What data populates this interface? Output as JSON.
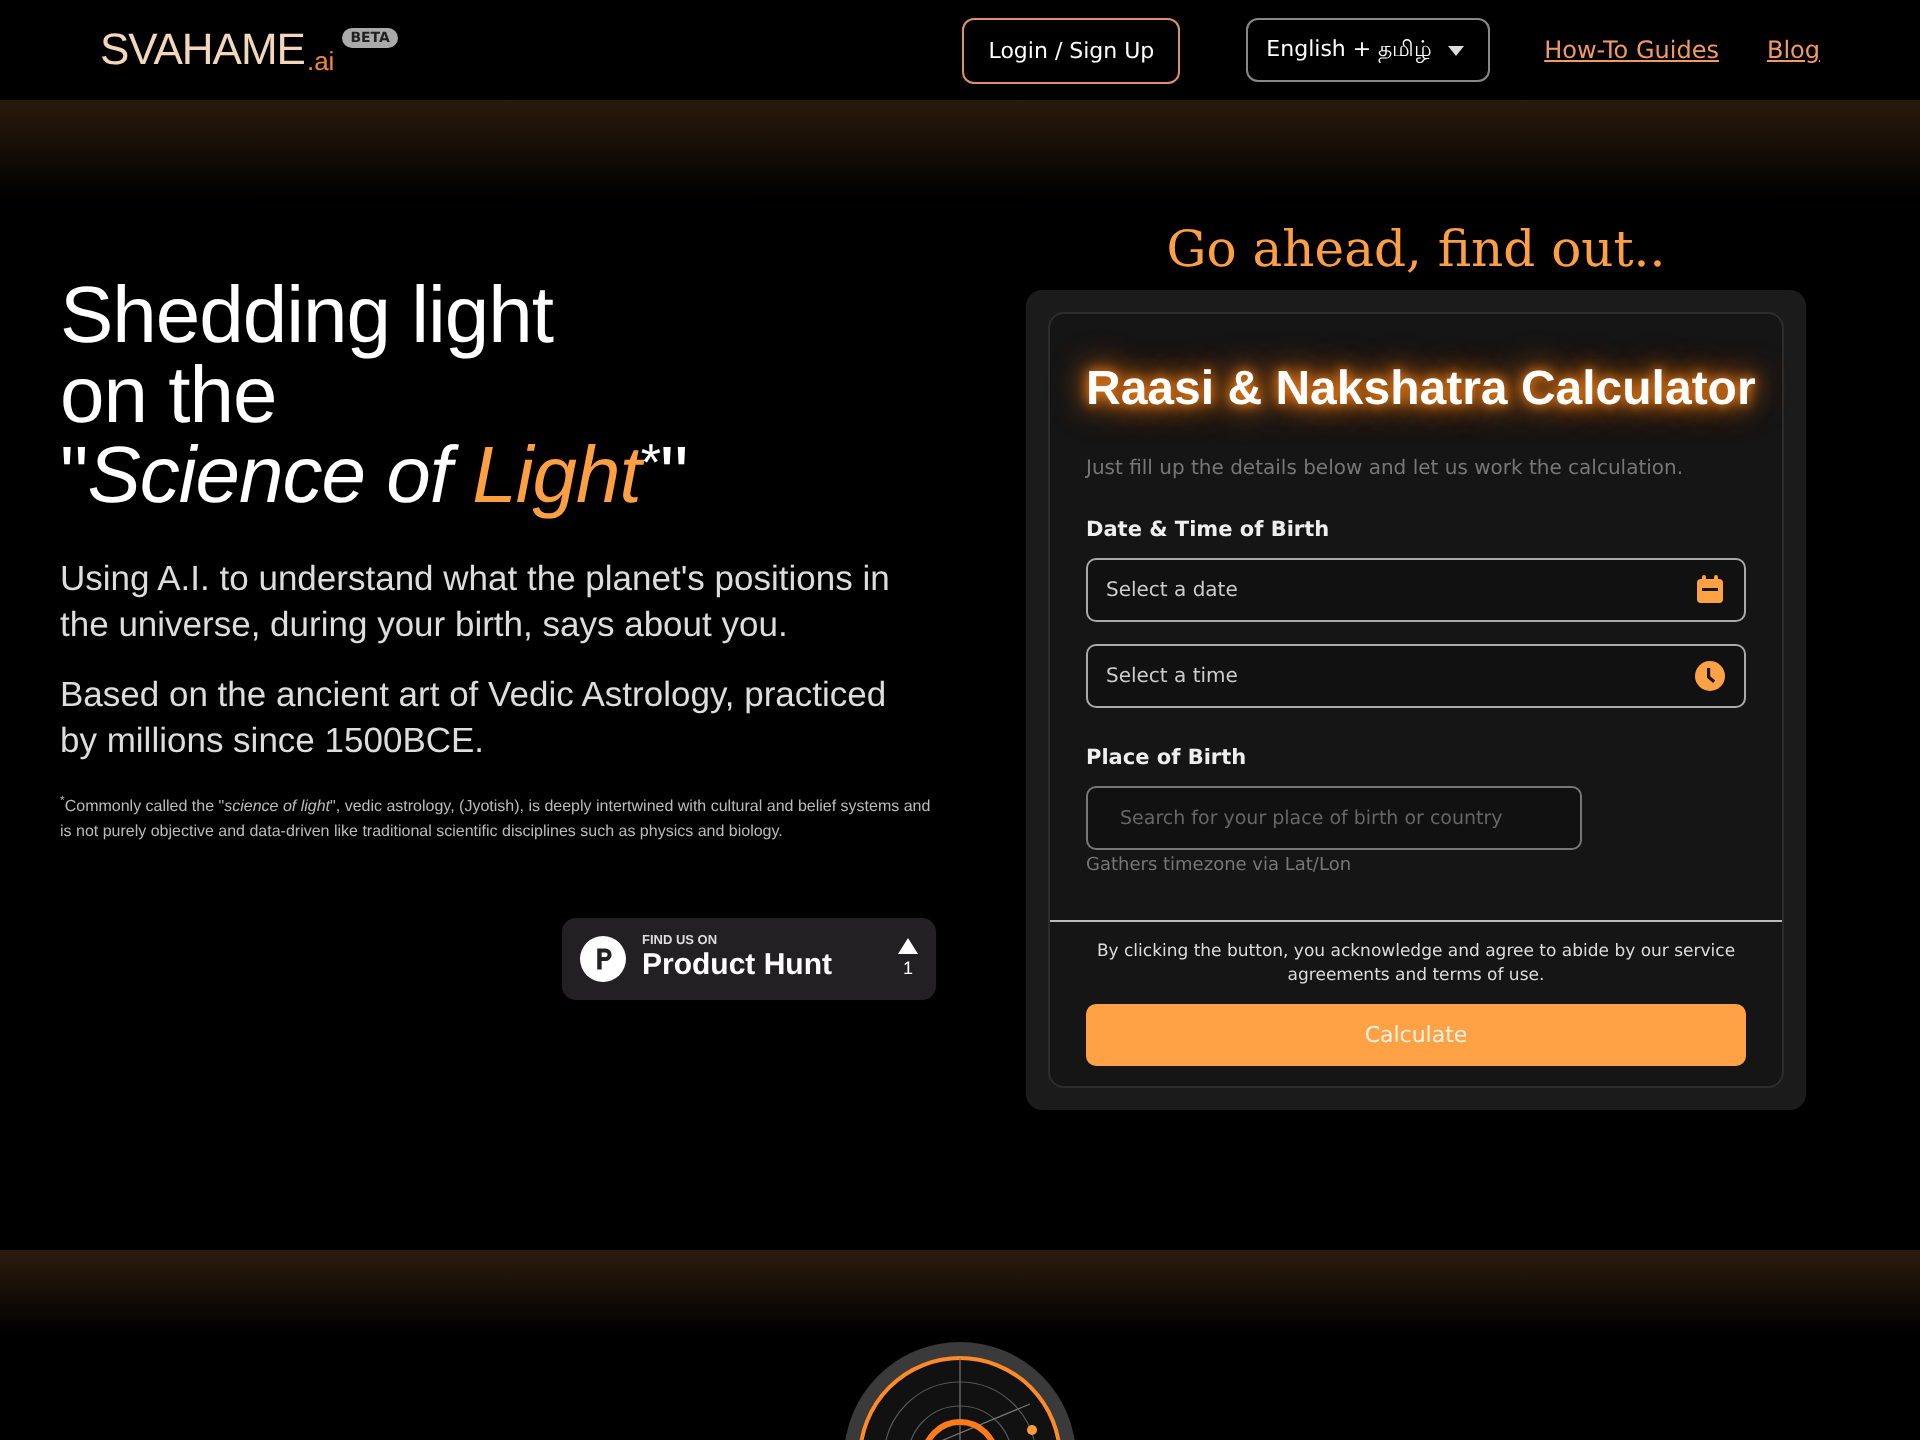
{
  "header": {
    "logo": {
      "name": "SVAHAME",
      "suffix": ".ai",
      "badge": "BETA"
    },
    "login_button": "Login / Sign Up",
    "language_select": "English + தமிழ்",
    "links": [
      "How-To Guides",
      "Blog"
    ]
  },
  "hero": {
    "heading": {
      "lines": [
        "Shedding light",
        "on the"
      ],
      "open_quote": "\"",
      "emphasis": "Science of ",
      "accent": "Light",
      "mark": "*",
      "close_quote": "\""
    },
    "paragraphs": [
      "Using A.I. to understand what the planet's positions in the universe, during your birth, says about you.",
      "Based on the ancient art of Vedic Astrology, practiced by millions since 1500BCE."
    ],
    "footnote": "$^{*}$Commonly called the \"*science of light*\", vedic astrology, (Jyotish), is deeply intertwined with cultural and belief systems and is not purely objective and data-driven like traditional scientific disciplines such as physics and biology.",
    "product_hunt": {
      "eyebrow": "FIND US ON",
      "name": "Product Hunt",
      "votes": "1"
    }
  },
  "calculator": {
    "tagline": "Go ahead, find out..",
    "title": "Raasi & Nakshatra Calculator",
    "subtitle": "Just fill up the details below and let us work the calculation.",
    "sections": [
      {
        "label": "Date & Time of Birth",
        "fields": [
          {
            "kind": "date",
            "placeholder": "Select a date"
          },
          {
            "kind": "time",
            "placeholder": "Select a time"
          }
        ]
      },
      {
        "label": "Place of Birth",
        "fields": [
          {
            "kind": "place",
            "placeholder": "Search for your place of birth or country",
            "hint": "Gathers timezone via Lat/Lon"
          }
        ]
      }
    ],
    "disclaimer": "By clicking the button, you acknowledge and agree to abide by our service agreements and terms of use.",
    "submit": "Calculate"
  }
}
